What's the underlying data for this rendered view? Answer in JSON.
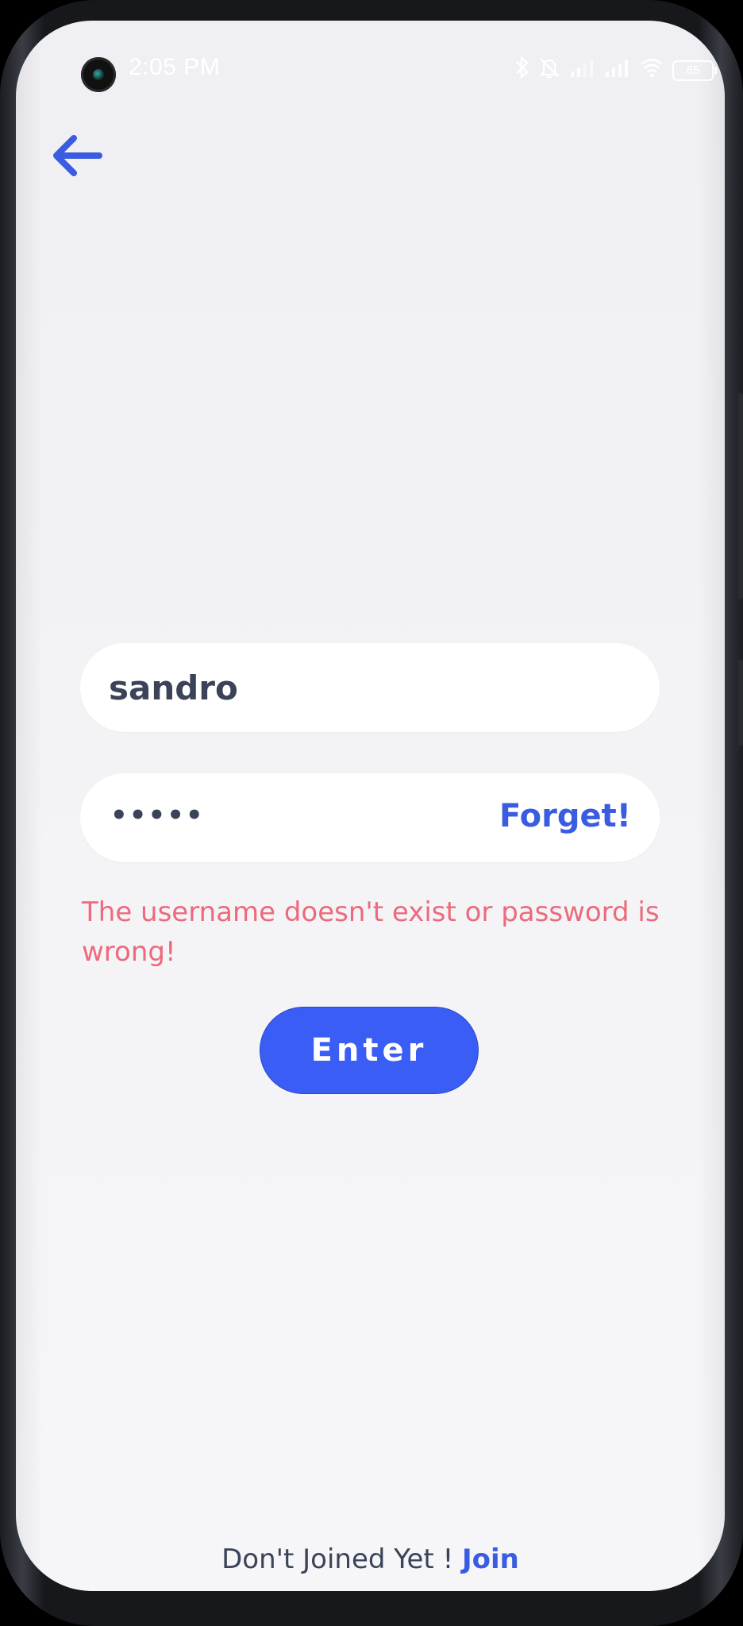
{
  "status_bar": {
    "time": "2:05 PM",
    "battery": "85",
    "icons": [
      "bluetooth-icon",
      "bell-off-icon",
      "signal-icon",
      "signal-icon",
      "wifi-icon",
      "battery-icon"
    ]
  },
  "nav": {
    "back_icon": "arrow-left-icon"
  },
  "login": {
    "username_value": "sandro",
    "password_mask": "•••••",
    "forget_label": "Forget!",
    "error_message": "The username doesn't exist or password is wrong!",
    "enter_label": "Enter"
  },
  "footer": {
    "prompt": "Don't Joined Yet ! ",
    "join_label": "Join"
  },
  "colors": {
    "accent": "#3a5ef5",
    "link": "#3a5ce0",
    "error": "#ec6a7c",
    "text": "#3b4358",
    "background": "#f2f2f6"
  }
}
